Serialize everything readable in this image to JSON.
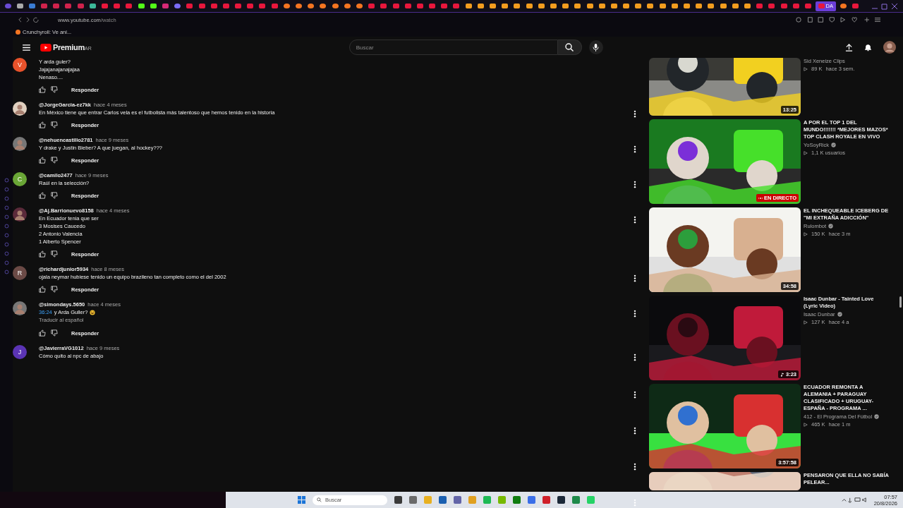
{
  "browser": {
    "tabs": [
      {
        "kind": "opera",
        "selected": false
      },
      {
        "kind": "gamepad",
        "selected": false
      },
      {
        "kind": "search",
        "selected": false
      },
      {
        "kind": "gx",
        "selected": false
      },
      {
        "kind": "gx",
        "selected": false
      },
      {
        "kind": "gx",
        "selected": false
      },
      {
        "kind": "gx",
        "selected": false
      },
      {
        "kind": "mint",
        "selected": false
      },
      {
        "kind": "video",
        "selected": false
      },
      {
        "kind": "video",
        "selected": false
      },
      {
        "kind": "video",
        "selected": false
      },
      {
        "kind": "kick",
        "selected": false
      },
      {
        "kind": "kick",
        "selected": false
      },
      {
        "kind": "insta",
        "selected": false
      },
      {
        "kind": "chat",
        "selected": false
      },
      {
        "kind": "video",
        "selected": false
      },
      {
        "kind": "video",
        "selected": false
      },
      {
        "kind": "video",
        "selected": false
      },
      {
        "kind": "video",
        "selected": false
      },
      {
        "kind": "video",
        "selected": false
      },
      {
        "kind": "video",
        "selected": false
      },
      {
        "kind": "video",
        "selected": false
      },
      {
        "kind": "video",
        "selected": false
      },
      {
        "kind": "cr",
        "selected": false
      },
      {
        "kind": "cr",
        "selected": false
      },
      {
        "kind": "cr",
        "selected": false
      },
      {
        "kind": "cr",
        "selected": false
      },
      {
        "kind": "cr",
        "selected": false
      },
      {
        "kind": "cr",
        "selected": false
      },
      {
        "kind": "cr",
        "selected": false
      },
      {
        "kind": "video",
        "selected": false
      },
      {
        "kind": "video",
        "selected": false
      },
      {
        "kind": "video",
        "selected": false
      },
      {
        "kind": "video",
        "selected": false
      },
      {
        "kind": "video",
        "selected": false
      },
      {
        "kind": "video",
        "selected": false
      },
      {
        "kind": "video",
        "selected": false
      },
      {
        "kind": "video",
        "selected": false
      },
      {
        "kind": "ph",
        "selected": false
      },
      {
        "kind": "ph",
        "selected": false
      },
      {
        "kind": "ph",
        "selected": false
      },
      {
        "kind": "ph",
        "selected": false
      },
      {
        "kind": "ph",
        "selected": false
      },
      {
        "kind": "ph",
        "selected": false
      },
      {
        "kind": "ph",
        "selected": false
      },
      {
        "kind": "ph",
        "selected": false
      },
      {
        "kind": "ph",
        "selected": false
      },
      {
        "kind": "ph",
        "selected": false
      },
      {
        "kind": "ph",
        "selected": false
      },
      {
        "kind": "ph",
        "selected": false
      },
      {
        "kind": "ph",
        "selected": false
      },
      {
        "kind": "ph",
        "selected": false
      },
      {
        "kind": "ph",
        "selected": false
      },
      {
        "kind": "ph",
        "selected": false
      },
      {
        "kind": "ph",
        "selected": false
      },
      {
        "kind": "ph",
        "selected": false
      },
      {
        "kind": "ph",
        "selected": false
      },
      {
        "kind": "ph",
        "selected": false
      },
      {
        "kind": "ph",
        "selected": false
      },
      {
        "kind": "ph",
        "selected": false
      },
      {
        "kind": "ph",
        "selected": false
      },
      {
        "kind": "ph",
        "selected": false
      },
      {
        "kind": "video",
        "selected": false
      },
      {
        "kind": "video",
        "selected": false
      },
      {
        "kind": "video",
        "selected": false
      },
      {
        "kind": "video",
        "selected": false
      },
      {
        "kind": "video",
        "selected": false
      },
      {
        "kind": "video",
        "selected": true,
        "label": "DA"
      },
      {
        "kind": "cr",
        "selected": false
      },
      {
        "kind": "video",
        "selected": false
      }
    ],
    "url_host": "www.youtube.com",
    "url_path": "/watch",
    "bookmark": "Crunchyroll: Ve ani..."
  },
  "header": {
    "logo": "Premium",
    "region": "AR",
    "search_placeholder": "Buscar"
  },
  "comments": [
    {
      "kind": "letter",
      "letter": "V",
      "color": "#e8522b",
      "text": "Y arda guler?\nJajajanajanajajaa\nNenaso....",
      "reply": "Responder"
    },
    {
      "user": "@JorgeGarcia-ez7kk",
      "time": "hace 4 meses",
      "text": "En México tiene que entrar Carlos vela es el futbolista más talentoso que hemos tenido en la historia",
      "reply": "Responder"
    },
    {
      "user": "@nehuencastillo2781",
      "time": "hace 9 meses",
      "text": "Y drake y Justin Bieber? A que juegan, al hockey???",
      "reply": "Responder"
    },
    {
      "kind": "letter",
      "letter": "C",
      "color": "#6aa636",
      "user": "@camilo2477",
      "time": "hace 9 meses",
      "text": "Raúl en la selección?",
      "reply": "Responder"
    },
    {
      "user": "@Aj.Barrionuevo8158",
      "time": "hace 4 meses",
      "text": "En Ecuador tenia que ser\n3 Mosises Caucedo\n2 Antonio Valencia\n1 Alberto Spencer",
      "reply": "Responder"
    },
    {
      "kind": "letter",
      "letter": "R",
      "color": "#6b4a46",
      "user": "@richardjunior5934",
      "time": "hace 8 meses",
      "text": "ojala neymar hubiese tenido un equipo brazileno tan completo como el del 2002",
      "reply": "Responder"
    },
    {
      "user": "@simondays.5650",
      "time": "hace 4 meses",
      "timestamp": "36:24",
      "text": "y Arda Guller?",
      "translate": "Traducir al español",
      "reply": "Responder"
    },
    {
      "kind": "letter",
      "letter": "J",
      "color": "#5b34b5",
      "user": "@JavierraVG1012",
      "time": "hace 9 meses",
      "text": "Cómo quito al npc de abajo"
    }
  ],
  "videos": [
    {
      "channel": "Sid Xeneize Clips",
      "views": "89 K",
      "age": "hace 3 sem.",
      "badge": {
        "kind": "time",
        "text": "13:25"
      }
    },
    {
      "title": "A POR EL TOP 1 DEL MUNDO!!!!!!! *MEJORES MAZOS* TOP CLASH ROYALE EN VIVO",
      "channel": "YoSoyRick",
      "verified": true,
      "views": "1,1 K usuarios",
      "badge": {
        "kind": "live",
        "text": "EN DIRECTO"
      }
    },
    {
      "title": "EL INCHEQUEABLE ICEBERG DE \"MI EXTRAÑA ADICCIÓN\"",
      "channel": "Rulombot",
      "verified": true,
      "views": "150 K",
      "age": "hace 3 m",
      "badge": {
        "kind": "time",
        "text": "34:58"
      }
    },
    {
      "title": "Isaac Dunbar - Tainted Love (Lyric Video)",
      "channel": "Isaac Dunbar",
      "verified": true,
      "views": "127 K",
      "age": "hace 4 a",
      "badge": {
        "kind": "music",
        "text": "3:23"
      }
    },
    {
      "title": "ECUADOR REMONTA A ALEMANIA + PARAGUAY CLASIFICADO + URUGUAY-ESPAÑA - PROGRAMA ...",
      "channel": "412 - El Programa Del Fútbol",
      "verified": true,
      "views": "465 K",
      "age": "hace 1 m",
      "badge": {
        "kind": "time",
        "text": "3:57:58"
      }
    },
    {
      "title": "PENSARON QUE ELLA NO SABÍA PELEAR..."
    }
  ],
  "taskbar": {
    "search_placeholder": "Buscar",
    "time": "07:57",
    "date": "20/8/2026"
  }
}
